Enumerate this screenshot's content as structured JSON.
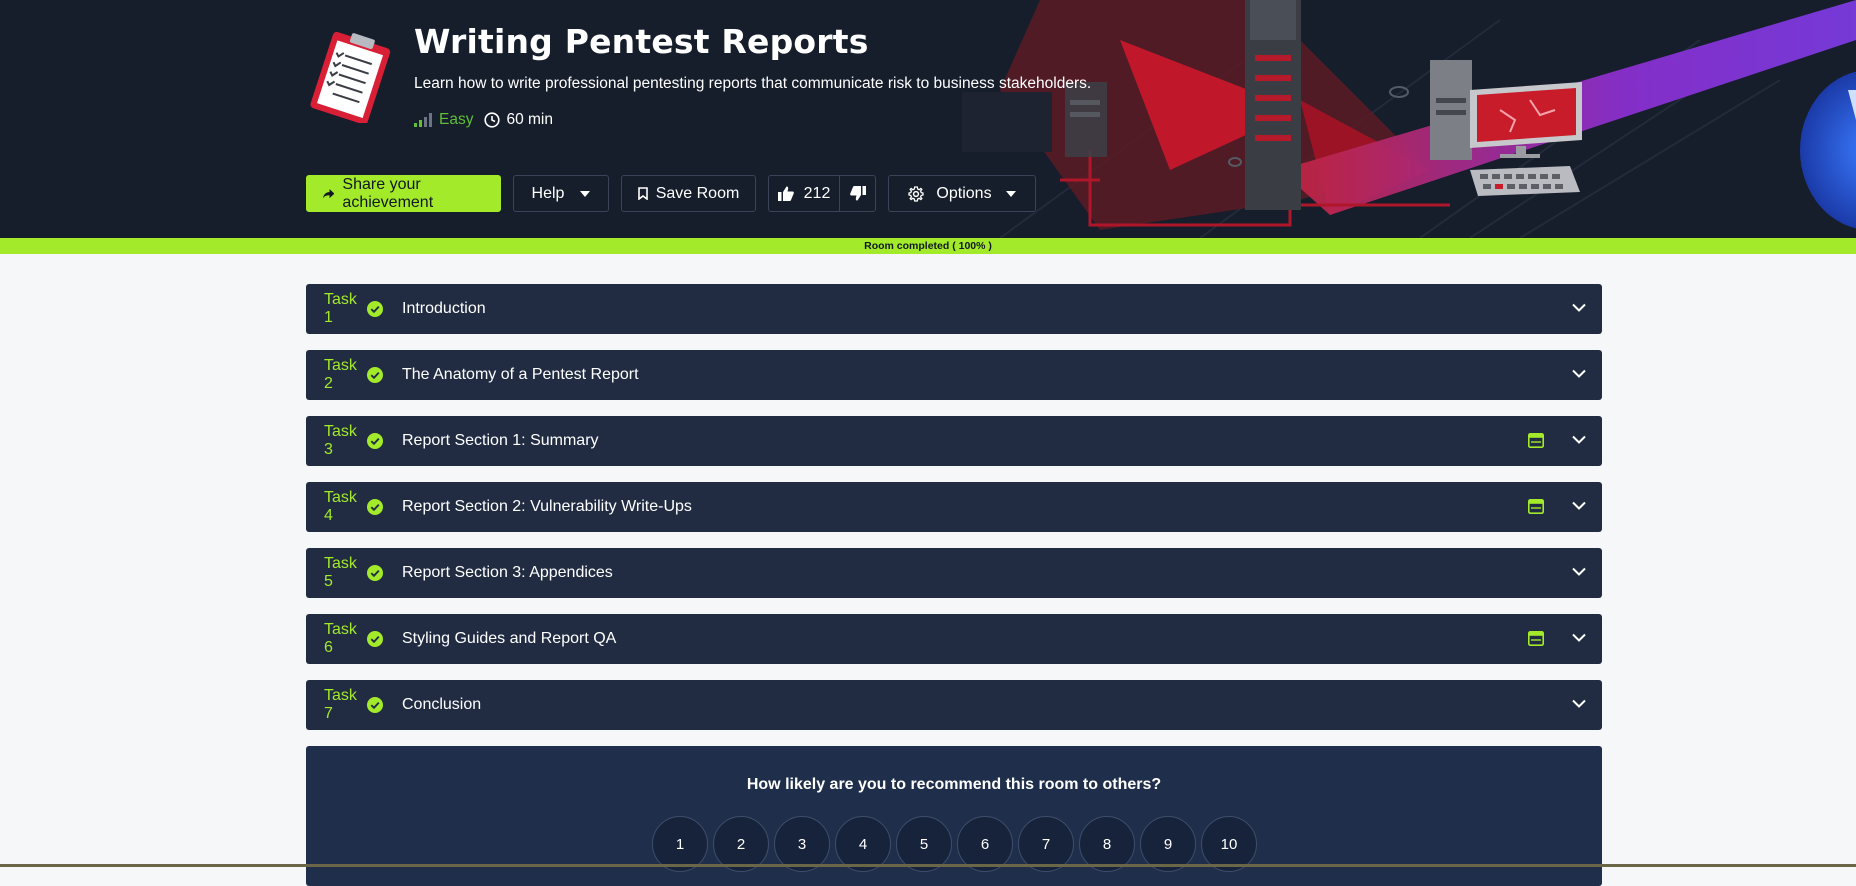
{
  "room": {
    "title": "Writing Pentest Reports",
    "description": "Learn how to write professional pentesting reports that communicate risk to business stakeholders.",
    "difficulty": "Easy",
    "duration": "60 min"
  },
  "actions": {
    "share_label": "Share your achievement",
    "help_label": "Help",
    "save_label": "Save Room",
    "upvotes": "212",
    "options_label": "Options"
  },
  "progress": {
    "label": "Room completed ( 100% )",
    "percent": 100
  },
  "tasks": [
    {
      "number": "Task 1",
      "title": "Introduction",
      "has_machine": false
    },
    {
      "number": "Task 2",
      "title": "The Anatomy of a Pentest Report",
      "has_machine": false
    },
    {
      "number": "Task 3",
      "title": "Report Section 1: Summary",
      "has_machine": true
    },
    {
      "number": "Task 4",
      "title": "Report Section 2: Vulnerability Write-Ups",
      "has_machine": true
    },
    {
      "number": "Task 5",
      "title": "Report Section 3: Appendices",
      "has_machine": false
    },
    {
      "number": "Task 6",
      "title": "Styling Guides and Report QA",
      "has_machine": true
    },
    {
      "number": "Task 7",
      "title": "Conclusion",
      "has_machine": false
    }
  ],
  "feedback": {
    "question": "How likely are you to recommend this room to others?",
    "ratings": [
      "1",
      "2",
      "3",
      "4",
      "5",
      "6",
      "7",
      "8",
      "9",
      "10"
    ]
  },
  "icons": {
    "room": "clipboard-report-icon",
    "difficulty": "signal-bars-icon",
    "duration": "clock-icon",
    "share": "share-arrow-icon",
    "save": "bookmark-icon",
    "upvote": "thumbs-up-icon",
    "downvote": "thumbs-down-icon",
    "options": "gear-icon",
    "completed": "check-circle-icon",
    "machine": "browser-window-icon",
    "expand": "chevron-down-icon"
  },
  "colors": {
    "accent": "#a3ea2a",
    "hero_bg": "#161d2b",
    "task_bg": "#212c42",
    "difficulty_easy": "#5fbf36",
    "feedback_bg": "#1f2f4b"
  }
}
